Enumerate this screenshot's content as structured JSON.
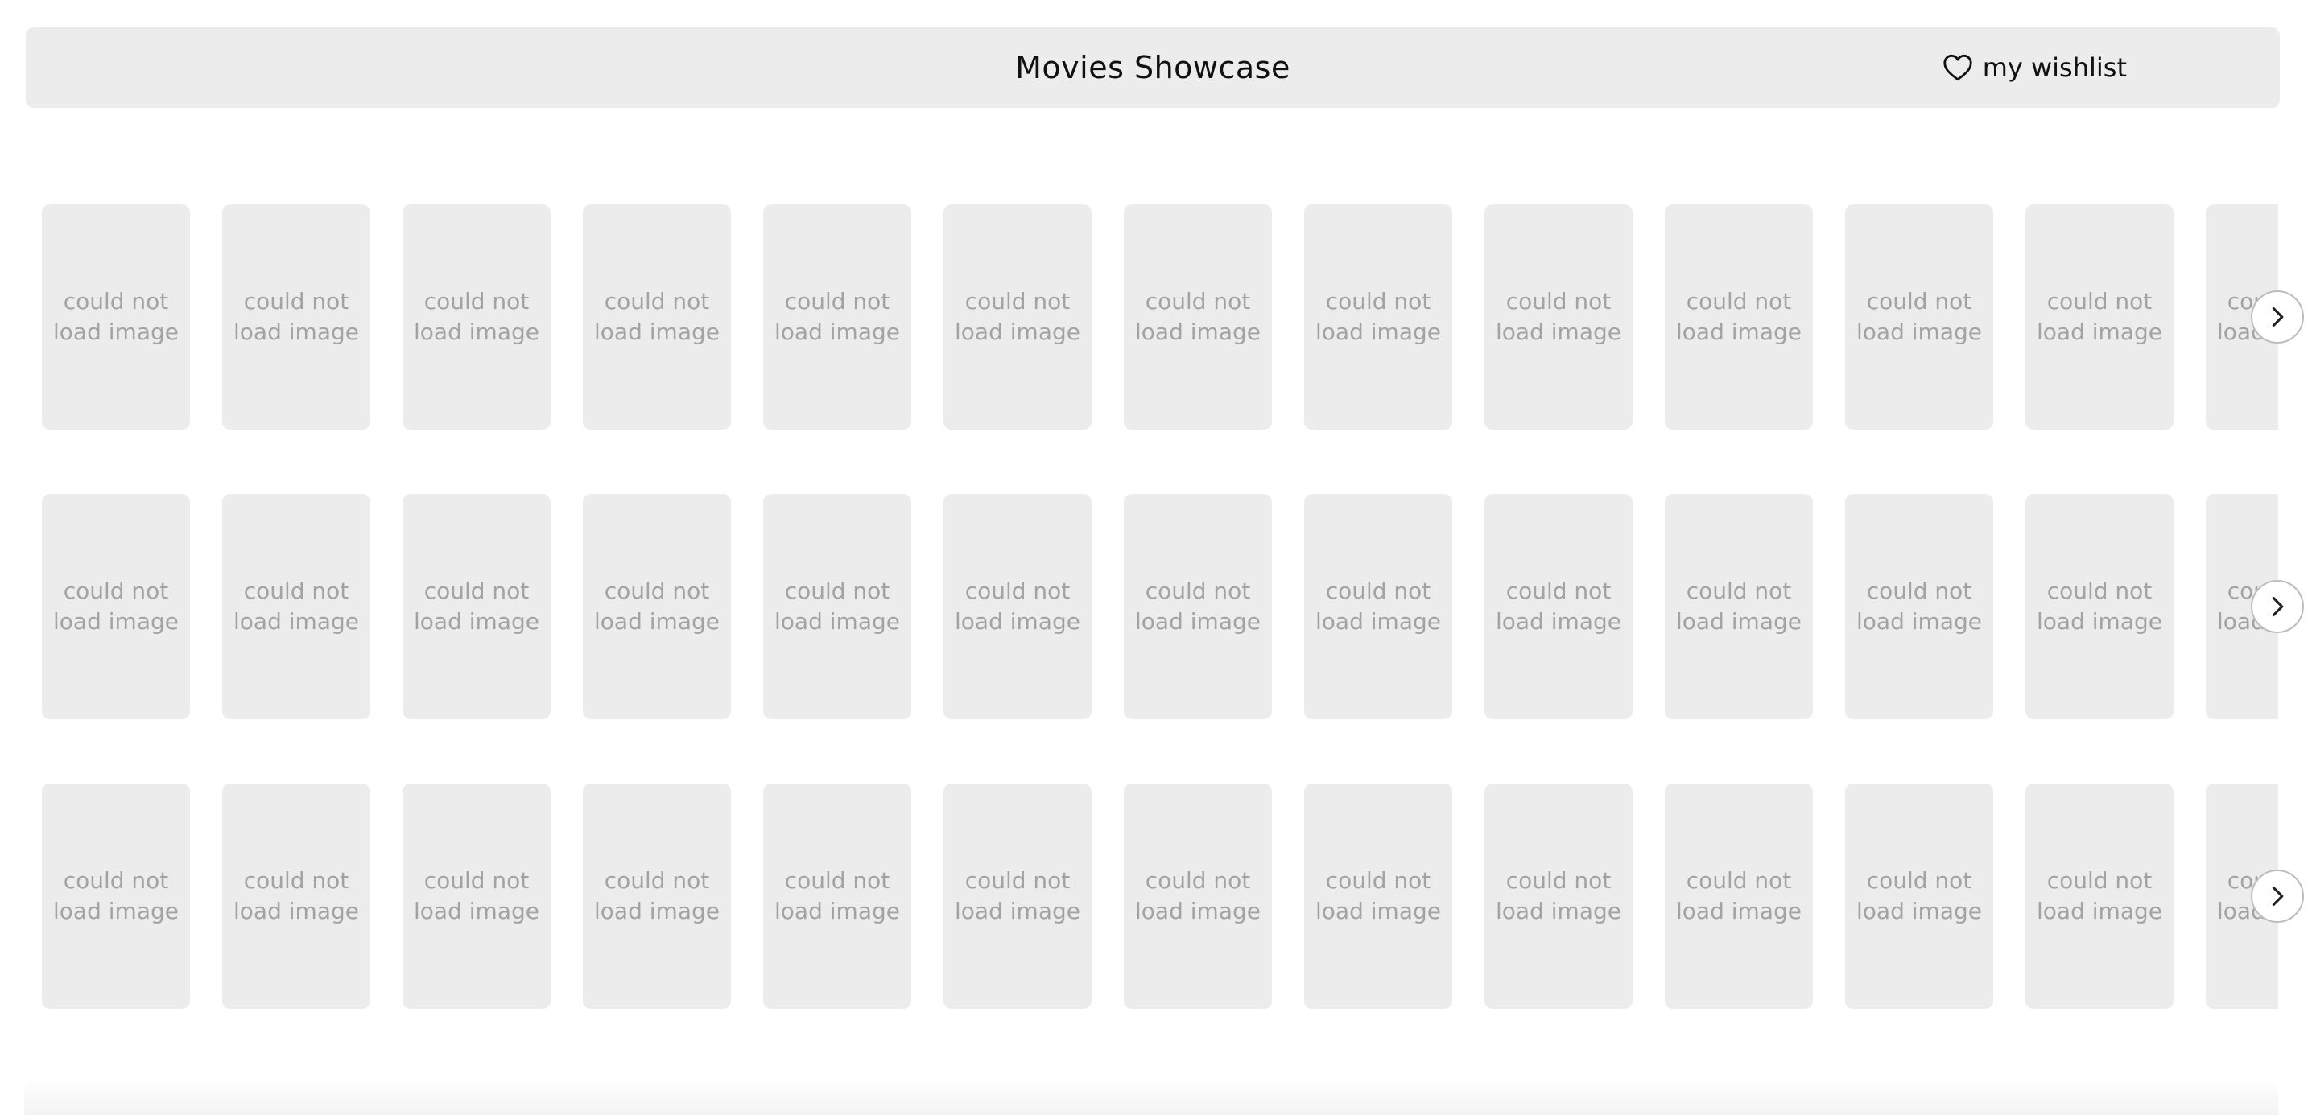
{
  "header": {
    "title": "Movies Showcase",
    "wishlist_label": "my wishlist",
    "wishlist_icon": "heart-icon"
  },
  "image_fallback_text": "could not\nload image",
  "rows": [
    {
      "visible_cards": 13,
      "next_icon": "chevron-right-icon"
    },
    {
      "visible_cards": 13,
      "next_icon": "chevron-right-icon"
    },
    {
      "visible_cards": 13,
      "next_icon": "chevron-right-icon"
    }
  ],
  "colors": {
    "header_bg": "#ececec",
    "card_bg": "#ececec",
    "fallback_text": "#a3a3a3"
  }
}
